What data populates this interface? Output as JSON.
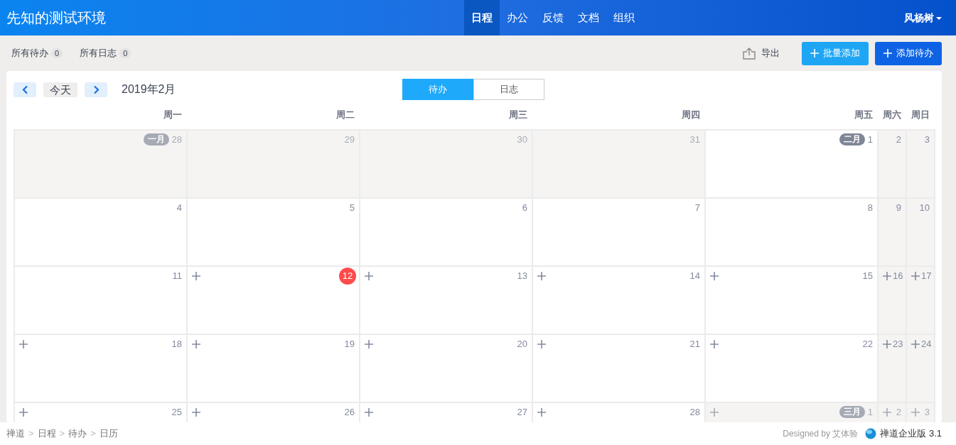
{
  "navbar": {
    "brand": "先知的测试环境",
    "items": [
      {
        "label": "日程",
        "selected": true
      },
      {
        "label": "办公",
        "selected": false
      },
      {
        "label": "反馈",
        "selected": false
      },
      {
        "label": "文档",
        "selected": false
      },
      {
        "label": "组织",
        "selected": false
      }
    ],
    "user": "风杨树"
  },
  "subheader": {
    "filters": [
      {
        "label": "所有待办",
        "count": "0"
      },
      {
        "label": "所有日志",
        "count": "0"
      }
    ],
    "export": "导出",
    "buttons": [
      {
        "label": "批量添加",
        "kind": "info"
      },
      {
        "label": "添加待办",
        "kind": "primary"
      }
    ]
  },
  "calendar": {
    "today_button": "今天",
    "month": "2019年2月",
    "views": [
      {
        "label": "待办",
        "selected": true
      },
      {
        "label": "日志",
        "selected": false
      }
    ],
    "columns": [
      {
        "label": "周一",
        "weekend": false
      },
      {
        "label": "周二",
        "weekend": false
      },
      {
        "label": "周三",
        "weekend": false
      },
      {
        "label": "周四",
        "weekend": false
      },
      {
        "label": "周五",
        "weekend": false
      },
      {
        "label": "周六",
        "weekend": true
      },
      {
        "label": "周日",
        "weekend": true
      }
    ],
    "weeks": [
      [
        {
          "day": "28",
          "month": "一月",
          "outside": true,
          "add": false,
          "today": false
        },
        {
          "day": "29",
          "outside": true,
          "add": false,
          "today": false
        },
        {
          "day": "30",
          "outside": true,
          "add": false,
          "today": false
        },
        {
          "day": "31",
          "outside": true,
          "add": false,
          "today": false
        },
        {
          "day": "1",
          "month": "二月",
          "outside": false,
          "add": false,
          "today": false
        },
        {
          "day": "2",
          "outside": false,
          "add": false,
          "today": false
        },
        {
          "day": "3",
          "outside": false,
          "add": false,
          "today": false
        }
      ],
      [
        {
          "day": "4",
          "outside": false,
          "add": false,
          "today": false
        },
        {
          "day": "5",
          "outside": false,
          "add": false,
          "today": false
        },
        {
          "day": "6",
          "outside": false,
          "add": false,
          "today": false
        },
        {
          "day": "7",
          "outside": false,
          "add": false,
          "today": false
        },
        {
          "day": "8",
          "outside": false,
          "add": false,
          "today": false
        },
        {
          "day": "9",
          "outside": false,
          "add": false,
          "today": false
        },
        {
          "day": "10",
          "outside": false,
          "add": false,
          "today": false
        }
      ],
      [
        {
          "day": "11",
          "outside": false,
          "add": false,
          "today": false
        },
        {
          "day": "12",
          "outside": false,
          "add": true,
          "today": true
        },
        {
          "day": "13",
          "outside": false,
          "add": true,
          "today": false
        },
        {
          "day": "14",
          "outside": false,
          "add": true,
          "today": false
        },
        {
          "day": "15",
          "outside": false,
          "add": true,
          "today": false
        },
        {
          "day": "16",
          "outside": false,
          "add": true,
          "today": false
        },
        {
          "day": "17",
          "outside": false,
          "add": true,
          "today": false
        }
      ],
      [
        {
          "day": "18",
          "outside": false,
          "add": true,
          "today": false
        },
        {
          "day": "19",
          "outside": false,
          "add": true,
          "today": false
        },
        {
          "day": "20",
          "outside": false,
          "add": true,
          "today": false
        },
        {
          "day": "21",
          "outside": false,
          "add": true,
          "today": false
        },
        {
          "day": "22",
          "outside": false,
          "add": true,
          "today": false
        },
        {
          "day": "23",
          "outside": false,
          "add": true,
          "today": false
        },
        {
          "day": "24",
          "outside": false,
          "add": true,
          "today": false
        }
      ],
      [
        {
          "day": "25",
          "outside": false,
          "add": true,
          "today": false
        },
        {
          "day": "26",
          "outside": false,
          "add": true,
          "today": false
        },
        {
          "day": "27",
          "outside": false,
          "add": true,
          "today": false
        },
        {
          "day": "28",
          "outside": false,
          "add": true,
          "today": false
        },
        {
          "day": "1",
          "month": "三月",
          "outside": true,
          "add": true,
          "today": false
        },
        {
          "day": "2",
          "outside": true,
          "add": true,
          "today": false
        },
        {
          "day": "3",
          "outside": true,
          "add": true,
          "today": false
        }
      ]
    ]
  },
  "footer": {
    "breadcrumb": [
      "禅道",
      "日程",
      "待办",
      "日历"
    ],
    "separator": ">",
    "designed_by": "Designed by 艾体验",
    "product": "禅道企业版 3.1"
  }
}
